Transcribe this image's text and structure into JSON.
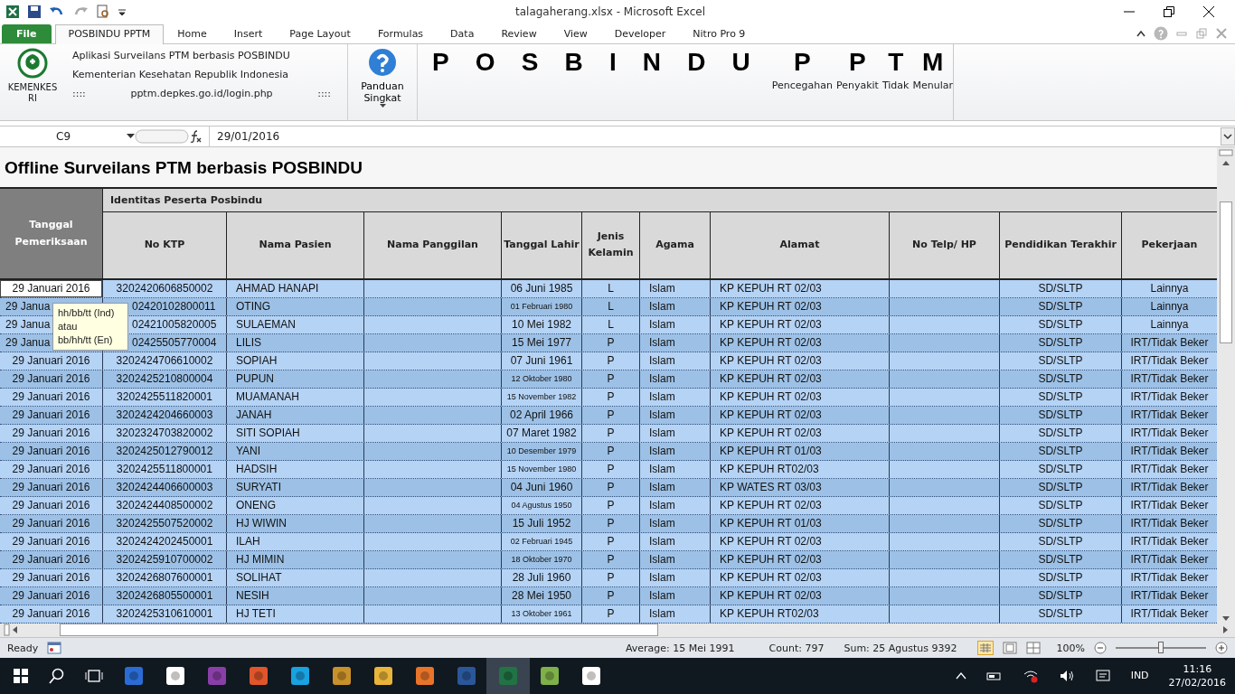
{
  "window": {
    "title": "talagaherang.xlsx  -  Microsoft Excel"
  },
  "ribbon_tabs": [
    {
      "label": "File",
      "kind": "file",
      "selected": false
    },
    {
      "label": "POSBINDU PPTM",
      "kind": "tab",
      "selected": true
    },
    {
      "label": "Home",
      "kind": "tab",
      "selected": false
    },
    {
      "label": "Insert",
      "kind": "tab",
      "selected": false
    },
    {
      "label": "Page Layout",
      "kind": "tab",
      "selected": false
    },
    {
      "label": "Formulas",
      "kind": "tab",
      "selected": false
    },
    {
      "label": "Data",
      "kind": "tab",
      "selected": false
    },
    {
      "label": "Review",
      "kind": "tab",
      "selected": false
    },
    {
      "label": "View",
      "kind": "tab",
      "selected": false
    },
    {
      "label": "Developer",
      "kind": "tab",
      "selected": false
    },
    {
      "label": "Nitro Pro 9",
      "kind": "tab",
      "selected": false
    }
  ],
  "ribbon": {
    "logo_label": "KEMENKES RI",
    "app_lines": [
      "Aplikasi Surveilans PTM berbasis POSBINDU",
      "Kementerian Kesehatan Republik Indonesia"
    ],
    "link_row": [
      "::::",
      "pptm.depkes.go.id/login.php",
      "::::"
    ],
    "guide_button": "Panduan Singkat",
    "big_letters": [
      "P",
      "O",
      "S",
      "B",
      "I",
      "N",
      "D",
      "U"
    ],
    "acronym": [
      {
        "letter": "P",
        "label": "Pencegahan"
      },
      {
        "letter": "P",
        "label": "Penyakit"
      },
      {
        "letter": "T",
        "label": "Tidak"
      },
      {
        "letter": "M",
        "label": "Menular"
      }
    ]
  },
  "formula_bar": {
    "name_box": "C9",
    "value": "29/01/2016"
  },
  "sheet": {
    "title": "Offline Surveilans PTM berbasis POSBINDU",
    "date_header": "Tanggal Pemeriksaan",
    "group_header": "Identitas Peserta Posbindu",
    "columns": [
      "No KTP",
      "Nama Pasien",
      "Nama Panggilan",
      "Tanggal Lahir",
      "Jenis Kelamin",
      "Agama",
      "Alamat",
      "No Telp/ HP",
      "Pendidikan Terakhir",
      "Pekerjaan"
    ],
    "rows": [
      {
        "active": true,
        "covered": false,
        "date": "29 Januari 2016",
        "ktp": "3202420606850002",
        "name": "AHMAD HANAPI",
        "birth": "06 Juni 1985",
        "sex": "L",
        "religion": "Islam",
        "address": "KP KEPUH RT 02/03",
        "education": "SD/SLTP",
        "job": "Lainnya"
      },
      {
        "active": false,
        "covered": true,
        "date": "29 Janua",
        "ktp": "02420102800011",
        "name": "OTING",
        "birth": "01 Februari 1980",
        "sex": "L",
        "religion": "Islam",
        "address": "KP KEPUH RT 02/03",
        "education": "SD/SLTP",
        "job": "Lainnya"
      },
      {
        "active": false,
        "covered": true,
        "date": "29 Janua",
        "ktp": "02421005820005",
        "name": "SULAEMAN",
        "birth": "10 Mei 1982",
        "sex": "L",
        "religion": "Islam",
        "address": "KP KEPUH RT 02/03",
        "education": "SD/SLTP",
        "job": "Lainnya"
      },
      {
        "active": false,
        "covered": true,
        "date": "29 Janua",
        "ktp": "02425505770004",
        "name": "LILIS",
        "birth": "15 Mei 1977",
        "sex": "P",
        "religion": "Islam",
        "address": "KP KEPUH RT 02/03",
        "education": "SD/SLTP",
        "job": "IRT/Tidak Beker"
      },
      {
        "active": false,
        "covered": false,
        "date": "29 Januari 2016",
        "ktp": "3202424706610002",
        "name": "SOPIAH",
        "birth": "07 Juni 1961",
        "sex": "P",
        "religion": "Islam",
        "address": "KP KEPUH RT 02/03",
        "education": "SD/SLTP",
        "job": "IRT/Tidak Beker"
      },
      {
        "active": false,
        "covered": false,
        "date": "29 Januari 2016",
        "ktp": "3202425210800004",
        "name": "PUPUN",
        "birth": "12 Oktober 1980",
        "sex": "P",
        "religion": "Islam",
        "address": "KP KEPUH RT 02/03",
        "education": "SD/SLTP",
        "job": "IRT/Tidak Beker"
      },
      {
        "active": false,
        "covered": false,
        "date": "29 Januari 2016",
        "ktp": "3202425511820001",
        "name": "MUAMANAH",
        "birth": "15 November 1982",
        "sex": "P",
        "religion": "Islam",
        "address": "KP KEPUH RT 02/03",
        "education": "SD/SLTP",
        "job": "IRT/Tidak Beker"
      },
      {
        "active": false,
        "covered": false,
        "date": "29 Januari 2016",
        "ktp": "3202424204660003",
        "name": "JANAH",
        "birth": "02 April 1966",
        "sex": "P",
        "religion": "Islam",
        "address": "KP KEPUH RT 02/03",
        "education": "SD/SLTP",
        "job": "IRT/Tidak Beker"
      },
      {
        "active": false,
        "covered": false,
        "date": "29 Januari 2016",
        "ktp": "3202324703820002",
        "name": "SITI SOPIAH",
        "birth": "07 Maret 1982",
        "sex": "P",
        "religion": "Islam",
        "address": "KP KEPUH RT 02/03",
        "education": "SD/SLTP",
        "job": "IRT/Tidak Beker"
      },
      {
        "active": false,
        "covered": false,
        "date": "29 Januari 2016",
        "ktp": "3202425012790012",
        "name": "YANI",
        "birth": "10 Desember 1979",
        "sex": "P",
        "religion": "Islam",
        "address": "KP KEPUH RT 01/03",
        "education": "SD/SLTP",
        "job": "IRT/Tidak Beker"
      },
      {
        "active": false,
        "covered": false,
        "date": "29 Januari 2016",
        "ktp": "3202425511800001",
        "name": "HADSIH",
        "birth": "15 November 1980",
        "sex": "P",
        "religion": "Islam",
        "address": "KP KEPUH RT02/03",
        "education": "SD/SLTP",
        "job": "IRT/Tidak Beker"
      },
      {
        "active": false,
        "covered": false,
        "date": "29 Januari 2016",
        "ktp": "3202424406600003",
        "name": "SURYATI",
        "birth": "04 Juni 1960",
        "sex": "P",
        "religion": "Islam",
        "address": "KP WATES RT 03/03",
        "education": "SD/SLTP",
        "job": "IRT/Tidak Beker"
      },
      {
        "active": false,
        "covered": false,
        "date": "29 Januari 2016",
        "ktp": "3202424408500002",
        "name": "ONENG",
        "birth": "04 Agustus 1950",
        "sex": "P",
        "religion": "Islam",
        "address": "KP KEPUH RT 02/03",
        "education": "SD/SLTP",
        "job": "IRT/Tidak Beker"
      },
      {
        "active": false,
        "covered": false,
        "date": "29 Januari 2016",
        "ktp": "3202425507520002",
        "name": "HJ WIWIN",
        "birth": "15 Juli 1952",
        "sex": "P",
        "religion": "Islam",
        "address": "KP KEPUH RT 01/03",
        "education": "SD/SLTP",
        "job": "IRT/Tidak Beker"
      },
      {
        "active": false,
        "covered": false,
        "date": "29 Januari 2016",
        "ktp": "3202424202450001",
        "name": "ILAH",
        "birth": "02 Februari 1945",
        "sex": "P",
        "religion": "Islam",
        "address": "KP KEPUH RT 02/03",
        "education": "SD/SLTP",
        "job": "IRT/Tidak Beker"
      },
      {
        "active": false,
        "covered": false,
        "date": "29 Januari 2016",
        "ktp": "3202425910700002",
        "name": "HJ MIMIN",
        "birth": "18 Oktober 1970",
        "sex": "P",
        "religion": "Islam",
        "address": "KP KEPUH RT 02/03",
        "education": "SD/SLTP",
        "job": "IRT/Tidak Beker"
      },
      {
        "active": false,
        "covered": false,
        "date": "29 Januari 2016",
        "ktp": "3202426807600001",
        "name": "SOLIHAT",
        "birth": "28 Juli 1960",
        "sex": "P",
        "religion": "Islam",
        "address": "KP KEPUH RT 02/03",
        "education": "SD/SLTP",
        "job": "IRT/Tidak Beker"
      },
      {
        "active": false,
        "covered": false,
        "date": "29 Januari 2016",
        "ktp": "3202426805500001",
        "name": "NESIH",
        "birth": "28 Mei 1950",
        "sex": "P",
        "religion": "Islam",
        "address": "KP KEPUH RT 02/03",
        "education": "SD/SLTP",
        "job": "IRT/Tidak Beker"
      },
      {
        "active": false,
        "covered": false,
        "date": "29 Januari 2016",
        "ktp": "3202425310610001",
        "name": "HJ TETI",
        "birth": "13 Oktober 1961",
        "sex": "P",
        "religion": "Islam",
        "address": "KP KEPUH RT02/03",
        "education": "SD/SLTP",
        "job": "IRT/Tidak Beker"
      }
    ],
    "tooltip": [
      "hh/bb/tt (Ind)",
      "atau",
      "bb/hh/tt (En)"
    ]
  },
  "status_bar": {
    "ready": "Ready",
    "average": "Average: 15 Mei 1991",
    "count": "Count: 797",
    "sum": "Sum: 25 Agustus 9392",
    "zoom": "100%",
    "zoom_level": {
      "level": 0.5
    }
  },
  "taskbar": {
    "language": "IND",
    "time": "11:16",
    "date": "27/02/2016"
  }
}
